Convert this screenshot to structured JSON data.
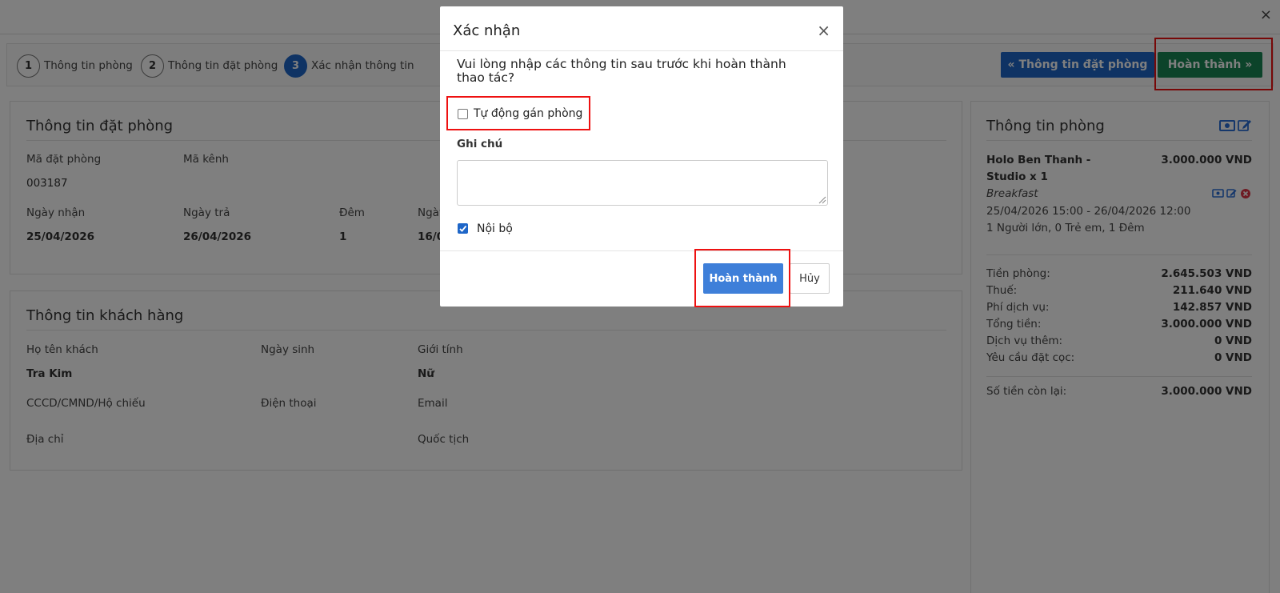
{
  "steps": [
    {
      "num": "1",
      "label": "Thông tin phòng"
    },
    {
      "num": "2",
      "label": "Thông tin đặt phòng"
    },
    {
      "num": "3",
      "label": "Xác nhận thông tin"
    }
  ],
  "toolbar": {
    "prev_label": "« Thông tin đặt phòng",
    "done_label": "Hoàn thành »"
  },
  "booking": {
    "title": "Thông tin đặt phòng",
    "code_label": "Mã đặt phòng",
    "code_value": "003187",
    "channel_label": "Mã kênh",
    "checkin_label": "Ngày nhận",
    "checkin_value": "25/04/2026",
    "checkout_label": "Ngày trả",
    "checkout_value": "26/04/2026",
    "nights_label": "Đêm",
    "nights_value": "1",
    "date_label_partial": "Ngày",
    "date_value_partial": "16/0"
  },
  "guest": {
    "title": "Thông tin khách hàng",
    "name_label": "Họ tên khách",
    "name_value": "Tra Kim",
    "dob_label": "Ngày sinh",
    "gender_label": "Giới tính",
    "gender_value": "Nữ",
    "id_label": "CCCD/CMND/Hộ chiếu",
    "phone_label": "Điện thoại",
    "email_label": "Email",
    "address_label": "Địa chỉ",
    "nationality_label": "Quốc tịch"
  },
  "room": {
    "title": "Thông tin phòng",
    "name_line1": "Holo Ben Thanh -",
    "name_line2": "Studio x 1",
    "price": "3.000.000 VND",
    "plan": "Breakfast",
    "dates": "25/04/2026 15:00 - 26/04/2026 12:00",
    "occupancy": "1 Người lớn, 0 Trẻ em, 1 Đêm",
    "summary": [
      {
        "label": "Tiền phòng:",
        "value": "2.645.503 VND"
      },
      {
        "label": "Thuế:",
        "value": "211.640 VND"
      },
      {
        "label": "Phí dịch vụ:",
        "value": "142.857 VND"
      },
      {
        "label": "Tổng tiền:",
        "value": "3.000.000 VND"
      },
      {
        "label": "Dịch vụ thêm:",
        "value": "0 VND"
      },
      {
        "label": "Yêu cầu đặt cọc:",
        "value": "0 VND"
      }
    ],
    "remaining_label": "Số tiền còn lại:",
    "remaining_value": "3.000.000 VND"
  },
  "modal": {
    "title": "Xác nhận",
    "close": "×",
    "question": "Vui lòng nhập các thông tin sau trước khi hoàn thành thao tác?",
    "auto_assign_label": "Tự động gán phòng",
    "auto_assign_checked": false,
    "note_label": "Ghi chú",
    "note_value": "",
    "internal_label": "Nội bộ",
    "internal_checked": true,
    "confirm_label": "Hoàn thành",
    "cancel_label": "Hủy"
  },
  "page_close": "×",
  "colors": {
    "primary": "#1e66c8",
    "success": "#198754",
    "modal_primary": "#3e7fd9",
    "highlight": "#ee1111",
    "danger": "#dc3545"
  }
}
